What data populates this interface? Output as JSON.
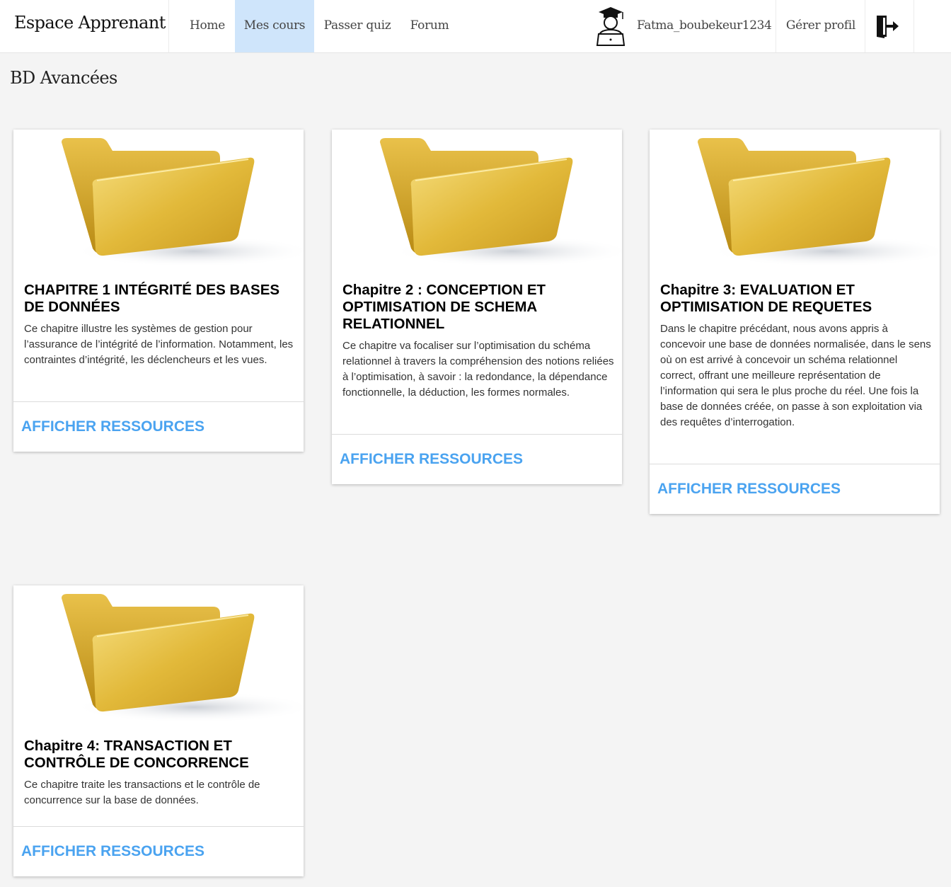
{
  "header": {
    "brand": "Espace Apprenant",
    "nav": [
      {
        "label": "Home",
        "active": false
      },
      {
        "label": "Mes cours",
        "active": true
      },
      {
        "label": "Passer quiz",
        "active": false
      },
      {
        "label": "Forum",
        "active": false
      }
    ],
    "username": "Fatma_boubekeur1234",
    "manage_profile": "Gérer profil",
    "icons": {
      "avatar": "student-graduate-icon",
      "logout": "logout-door-icon"
    },
    "active_color": "#cfe5fb"
  },
  "page": {
    "title": "BD Avancées"
  },
  "cards": [
    {
      "title": "CHAPITRE 1 INTÉGRITÉ DES BASES DE DONNÉES",
      "description": "Ce chapitre illustre les systèmes de gestion pour l’assurance de l’intégrité de l’information. Notamment, les contraintes d’intégrité, les déclencheurs et les vues.",
      "action": "AFFICHER RESSOURCES"
    },
    {
      "title": "Chapitre 2 : CONCEPTION ET OPTIMISATION DE SCHEMA RELATIONNEL",
      "description": "Ce chapitre va focaliser sur l’optimisation du schéma relationnel à travers la compréhension des notions reliées à l’optimisation, à savoir : la redondance, la dépendance fonctionnelle, la déduction, les formes normales.",
      "action": "AFFICHER RESSOURCES"
    },
    {
      "title": "Chapitre 3: EVALUATION ET OPTIMISATION DE REQUETES",
      "description": "Dans le chapitre précédant, nous avons appris à concevoir une base de données normalisée, dans le sens où on est arrivé à concevoir un schéma relationnel correct, offrant une meilleure représentation de l’information qui sera le plus proche du réel. Une fois la base de données créée, on passe à son exploitation via des requêtes d’interrogation.",
      "action": "AFFICHER RESSOURCES"
    },
    {
      "title": "Chapitre 4: TRANSACTION ET CONTRÔLE DE CONCORRENCE",
      "description": "Ce chapitre traite les transactions et le contrôle de concurrence sur la base de données.",
      "action": "AFFICHER RESSOURCES"
    }
  ],
  "accent_color": "#4aa3f0",
  "folder_icon": "folder-icon"
}
